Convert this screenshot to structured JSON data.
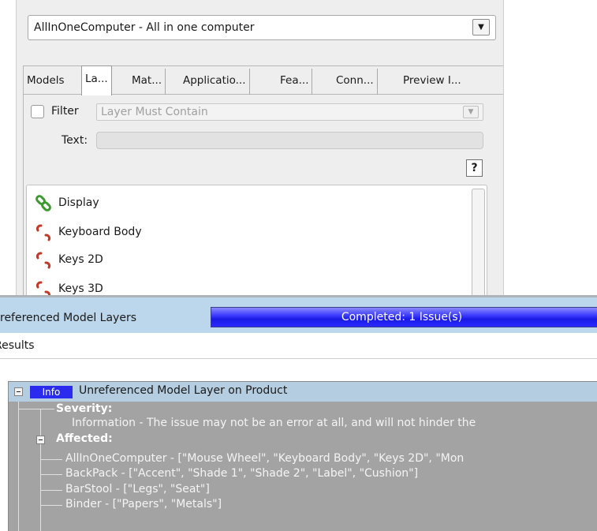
{
  "model_selector": {
    "value": "AllInOneComputer - All in one computer"
  },
  "tabs": [
    {
      "label": "Models"
    },
    {
      "label": "La..."
    },
    {
      "label": "Mat..."
    },
    {
      "label": "Applicatio..."
    },
    {
      "label": "Fea..."
    },
    {
      "label": "Conn..."
    },
    {
      "label": "Preview I..."
    }
  ],
  "filter": {
    "label": "Filter",
    "placeholder": "Layer Must Contain",
    "text_label": "Text:",
    "help_label": "?"
  },
  "layers": [
    {
      "label": "Display",
      "icon": "linked-chain-icon"
    },
    {
      "label": "Keyboard Body",
      "icon": "broken-chain-icon"
    },
    {
      "label": "Keys 2D",
      "icon": "broken-chain-icon"
    },
    {
      "label": "Keys 3D",
      "icon": "broken-chain-icon"
    }
  ],
  "status": {
    "label": "referenced Model Layers",
    "progress_text": "Completed: 1 Issue(s)",
    "progress_value": 1.0
  },
  "results": {
    "label": "Results",
    "header": {
      "badge": "Info",
      "title": "Unreferenced Model Layer on Product"
    },
    "severity_label": "Severity:",
    "severity_text": "Information - The issue may not be an error at all, and will not hinder the",
    "affected_label": "Affected:",
    "affected": [
      "AllInOneComputer - [\"Mouse Wheel\", \"Keyboard Body\", \"Keys 2D\", \"Mon",
      "BackPack - [\"Accent\", \"Shade 1\", \"Shade 2\", \"Label\", \"Cushion\"]",
      "BarStool - [\"Legs\", \"Seat\"]",
      "Binder - [\"Papers\", \"Metals\"]"
    ]
  },
  "colors": {
    "progress": "#1a1ae6",
    "status_bar": "#bcd7ec",
    "tree_background": "#a3a3a3",
    "selected_row": "#b5cde0"
  }
}
